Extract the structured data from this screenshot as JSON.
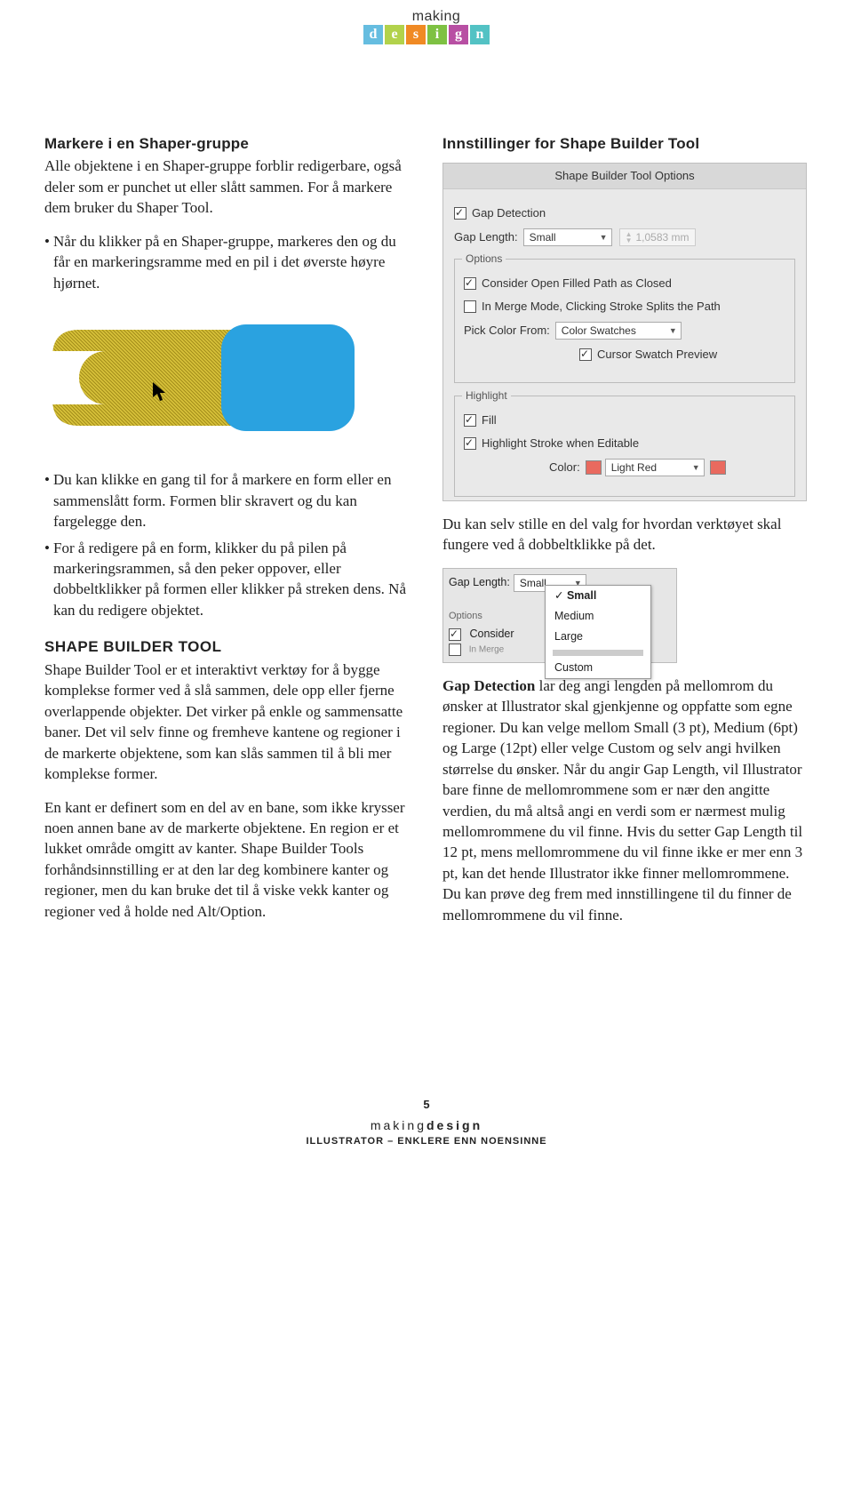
{
  "logo": {
    "top": "making",
    "letters": [
      "d",
      "e",
      "s",
      "i",
      "g",
      "n"
    ]
  },
  "left": {
    "h1": "Markere i en Shaper-gruppe",
    "p1a": "Alle objektene i en Shaper-gruppe forblir redigerbare, også deler som er punchet ut eller slått sammen. For å markere dem bruker du Shaper Tool.",
    "p1b": "Når du klikker på en Shaper-gruppe, markeres den og du får en markeringsramme med en pil i det øverste høyre hjørnet.",
    "b1": "Du kan klikke en gang til for å markere en form eller en sammenslått form. Formen blir skravert og du kan fargelegge den.",
    "b2": "For å redigere på en form, klikker du på pilen på markeringsrammen, så den peker oppover, eller dobbeltklikker på formen eller klikker på streken dens. Nå kan du redigere objektet.",
    "h2": "SHAPE BUILDER TOOL",
    "p2": "Shape Builder Tool er et interaktivt verktøy for å bygge komplekse former ved å slå sammen, dele opp eller fjerne overlappende objekter. Det virker på enkle og sammensatte baner. Det vil selv finne og fremheve kantene og regioner i de markerte objektene, som kan slås sammen til å bli mer komplekse former.",
    "p3": "En kant er definert som en del av en bane, som ikke krysser noen annen bane av de markerte objektene. En region er et lukket område omgitt av kanter. Shape Builder Tools forhåndsinnstilling er at den lar deg kombinere kanter og regioner, men du kan bruke det til å viske vekk kanter og regioner ved å holde ned Alt/Option."
  },
  "right": {
    "h1": "Innstillinger for Shape Builder Tool",
    "panel": {
      "title": "Shape Builder Tool Options",
      "gapDetection": "Gap Detection",
      "gapLengthLabel": "Gap Length:",
      "gapLengthValue": "Small",
      "gapLengthMm": "1,0583 mm",
      "optionsLegend": "Options",
      "opt1": "Consider Open Filled Path as Closed",
      "opt2": "In Merge Mode, Clicking Stroke Splits the Path",
      "pickColorLabel": "Pick Color From:",
      "pickColorValue": "Color Swatches",
      "cursorPreview": "Cursor Swatch Preview",
      "highlightLegend": "Highlight",
      "fill": "Fill",
      "hlStroke": "Highlight Stroke when Editable",
      "colorLabel": "Color:",
      "colorValue": "Light Red"
    },
    "p1": "Du kan selv stille en del valg for hvordan verktøyet skal fungere ved å dobbeltklikke på det.",
    "mini": {
      "gapLengthLabel": "Gap Length:",
      "selected": "Small",
      "items": [
        "Small",
        "Medium",
        "Large",
        "Custom"
      ],
      "optionsLabel": "Options",
      "consider": "Consider",
      "merge": "In Merge"
    },
    "p2": "<b>Gap Detection</b> lar deg angi lengden på mellomrom du ønsker at Illustrator skal gjenkjenne og oppfatte som egne regioner. Du kan velge mellom Small (3 pt), Medium (6pt) og Large (12pt) eller velge Custom og selv angi hvilken størrelse du ønsker. Når du angir Gap Length, vil Illustrator bare finne de mellomrommene som er nær den angitte verdien, du må altså angi en verdi som er nærmest mulig mellomrommene du vil finne. Hvis du setter Gap Length til 12 pt, mens mellomrommene du vil finne ikke er mer enn 3 pt, kan det hende Illustrator ikke finner mellomrommene. Du kan prøve deg frem med innstillingene til du finner de mellomrommene du vil finne."
  },
  "footer": {
    "page": "5",
    "brand": "makingdesign",
    "sub": "illustrator – enklere enn noensinne"
  }
}
